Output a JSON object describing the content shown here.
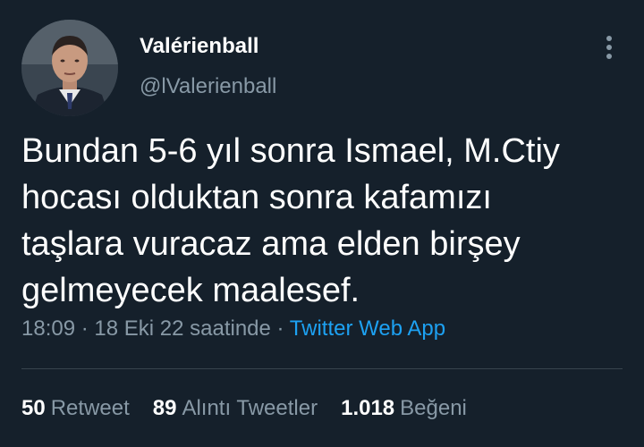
{
  "author": {
    "display_name": "Valérienball",
    "handle": "@lValerienball",
    "avatar_icon": "profile-photo"
  },
  "tweet": {
    "text": "Bundan 5-6 yıl sonra Ismael, M.Ctiy\nhocası olduktan sonra kafamızı\ntaşlara vuracaz ama elden birşey\ngelmeyecek maalesef."
  },
  "meta": {
    "time": "18:09",
    "separator": " · ",
    "date": "18 Eki 22 saatinde",
    "source": "Twitter Web App"
  },
  "stats": {
    "retweets_count": "50",
    "retweets_label": "Retweet",
    "quotes_count": "89",
    "quotes_label": "Alıntı Tweetler",
    "likes_count": "1.018",
    "likes_label": "Beğeni"
  },
  "colors": {
    "background": "#15202b",
    "text_primary": "#ffffff",
    "text_secondary": "#8899a6",
    "link": "#1da1f2",
    "divider": "#38444d"
  },
  "icons": {
    "more": "more-vertical-icon"
  }
}
